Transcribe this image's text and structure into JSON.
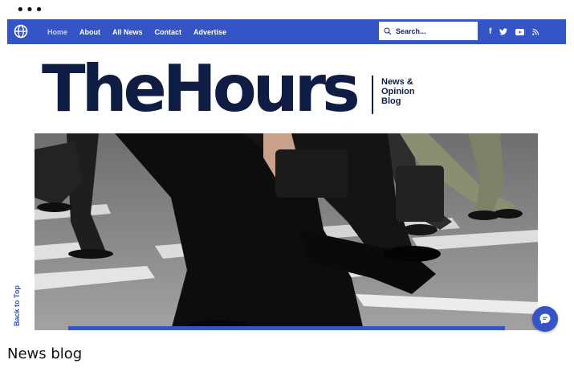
{
  "window": {
    "menu_dots": "•••"
  },
  "nav": {
    "links": [
      {
        "label": "Home",
        "active": true
      },
      {
        "label": "About"
      },
      {
        "label": "All News"
      },
      {
        "label": "Contact"
      },
      {
        "label": "Advertise"
      }
    ],
    "search_placeholder": "Search...",
    "social": [
      "facebook-icon",
      "twitter-icon",
      "youtube-icon",
      "rss-icon"
    ],
    "bar_color": "#3554c7"
  },
  "brand": {
    "logo": "TheHours",
    "tagline_1": "News &",
    "tagline_2": "Opinion",
    "tagline_3": "Blog"
  },
  "hero": {
    "subject": "pedestrians-walking-crosswalk"
  },
  "back_to_top": "Back to Top",
  "section_title": "News blog",
  "colors": {
    "brand_blue": "#3554c7",
    "navy": "#0f1d45"
  }
}
